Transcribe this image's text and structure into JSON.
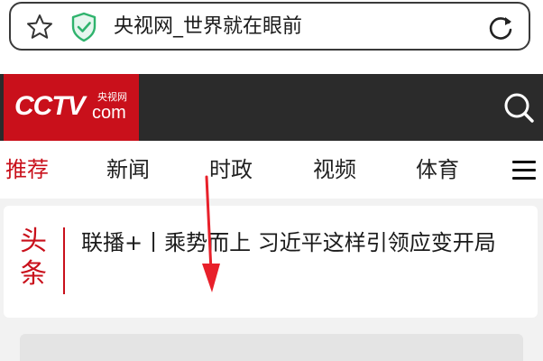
{
  "browser": {
    "page_title": "央视网_世界就在眼前",
    "icons": {
      "bookmark": "star-outline",
      "security": "shield-check",
      "reload": "reload-circle-arrow"
    }
  },
  "site": {
    "logo": {
      "main": "CCTV",
      "cn": "央视网",
      "com": "com"
    },
    "colors": {
      "brand_red": "#c9101b",
      "header_dark": "#2b2b2b",
      "shield_green": "#2fb36d"
    }
  },
  "nav": {
    "tabs": [
      {
        "label": "推荐",
        "active": true
      },
      {
        "label": "新闻",
        "active": false
      },
      {
        "label": "时政",
        "active": false
      },
      {
        "label": "视频",
        "active": false
      },
      {
        "label": "体育",
        "active": false
      }
    ]
  },
  "headline": {
    "tag_line1": "头",
    "tag_line2": "条",
    "title": "联播+丨乘势而上 习近平这样引领应变开局"
  }
}
